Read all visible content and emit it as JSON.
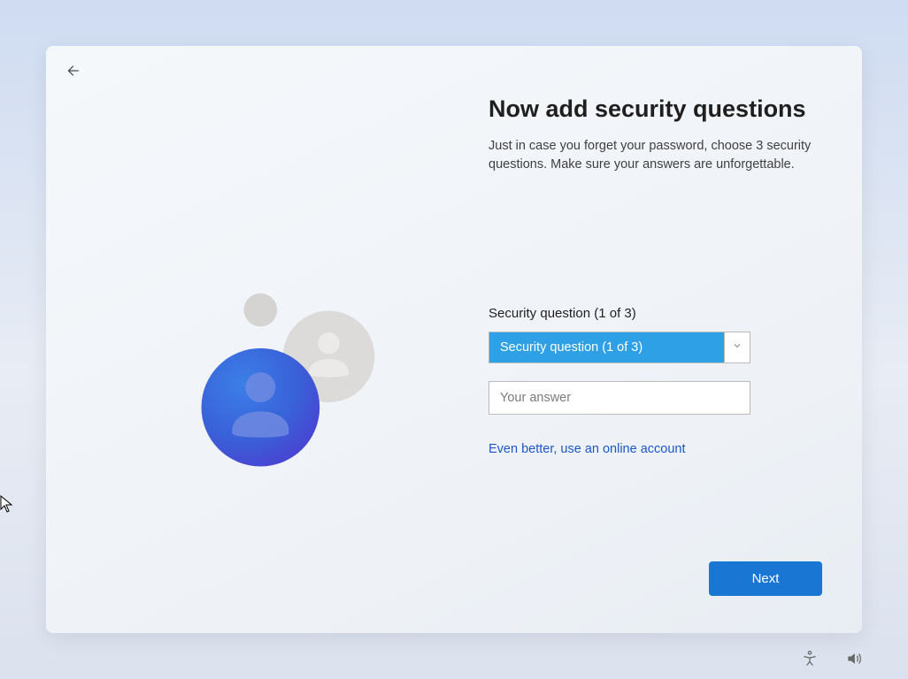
{
  "main": {
    "title": "Now add security questions",
    "subtitle": "Just in case you forget your password, choose 3 security questions. Make sure your answers are unforgettable.",
    "question_label": "Security question (1 of 3)",
    "question_selected": "Security question (1 of 3)",
    "answer_placeholder": "Your answer",
    "online_account_link": "Even better, use an online account",
    "next_button": "Next"
  },
  "icons": {
    "back": "back-arrow-icon",
    "chevron": "chevron-down-icon",
    "accessibility": "accessibility-icon",
    "volume": "volume-icon",
    "cursor": "mouse-cursor"
  }
}
